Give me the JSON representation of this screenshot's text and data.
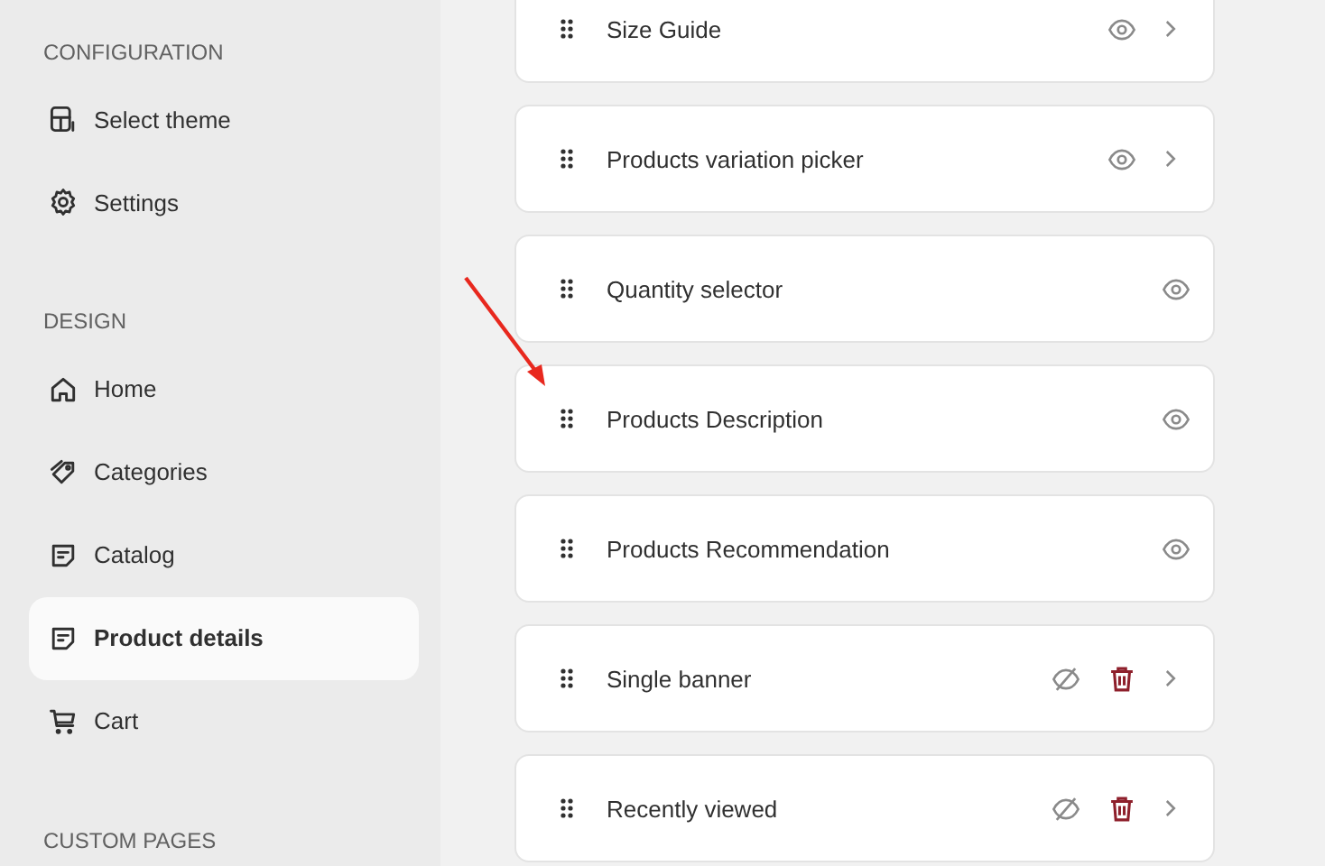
{
  "sidebar": {
    "sections": [
      {
        "heading": "CONFIGURATION",
        "items": [
          {
            "label": "Select theme",
            "kind": "theme",
            "selected": false
          },
          {
            "label": "Settings",
            "kind": "settings",
            "selected": false
          }
        ]
      },
      {
        "heading": "DESIGN",
        "items": [
          {
            "label": "Home",
            "kind": "home",
            "selected": false
          },
          {
            "label": "Categories",
            "kind": "tag",
            "selected": false
          },
          {
            "label": "Catalog",
            "kind": "catalog",
            "selected": false
          },
          {
            "label": "Product details",
            "kind": "catalog",
            "selected": true
          },
          {
            "label": "Cart",
            "kind": "cart",
            "selected": false
          }
        ]
      },
      {
        "heading": "CUSTOM PAGES"
      }
    ]
  },
  "blocks": [
    {
      "label": "Size Guide",
      "visible": true,
      "deletable": false,
      "expandable": true
    },
    {
      "label": "Products variation picker",
      "visible": true,
      "deletable": false,
      "expandable": true
    },
    {
      "label": "Quantity selector",
      "visible": true,
      "deletable": false,
      "expandable": false
    },
    {
      "label": "Products Description",
      "visible": true,
      "deletable": false,
      "expandable": false
    },
    {
      "label": "Products Recommendation",
      "visible": true,
      "deletable": false,
      "expandable": false
    },
    {
      "label": "Single banner",
      "visible": false,
      "deletable": true,
      "expandable": true
    },
    {
      "label": "Recently viewed",
      "visible": false,
      "deletable": true,
      "expandable": true
    }
  ]
}
